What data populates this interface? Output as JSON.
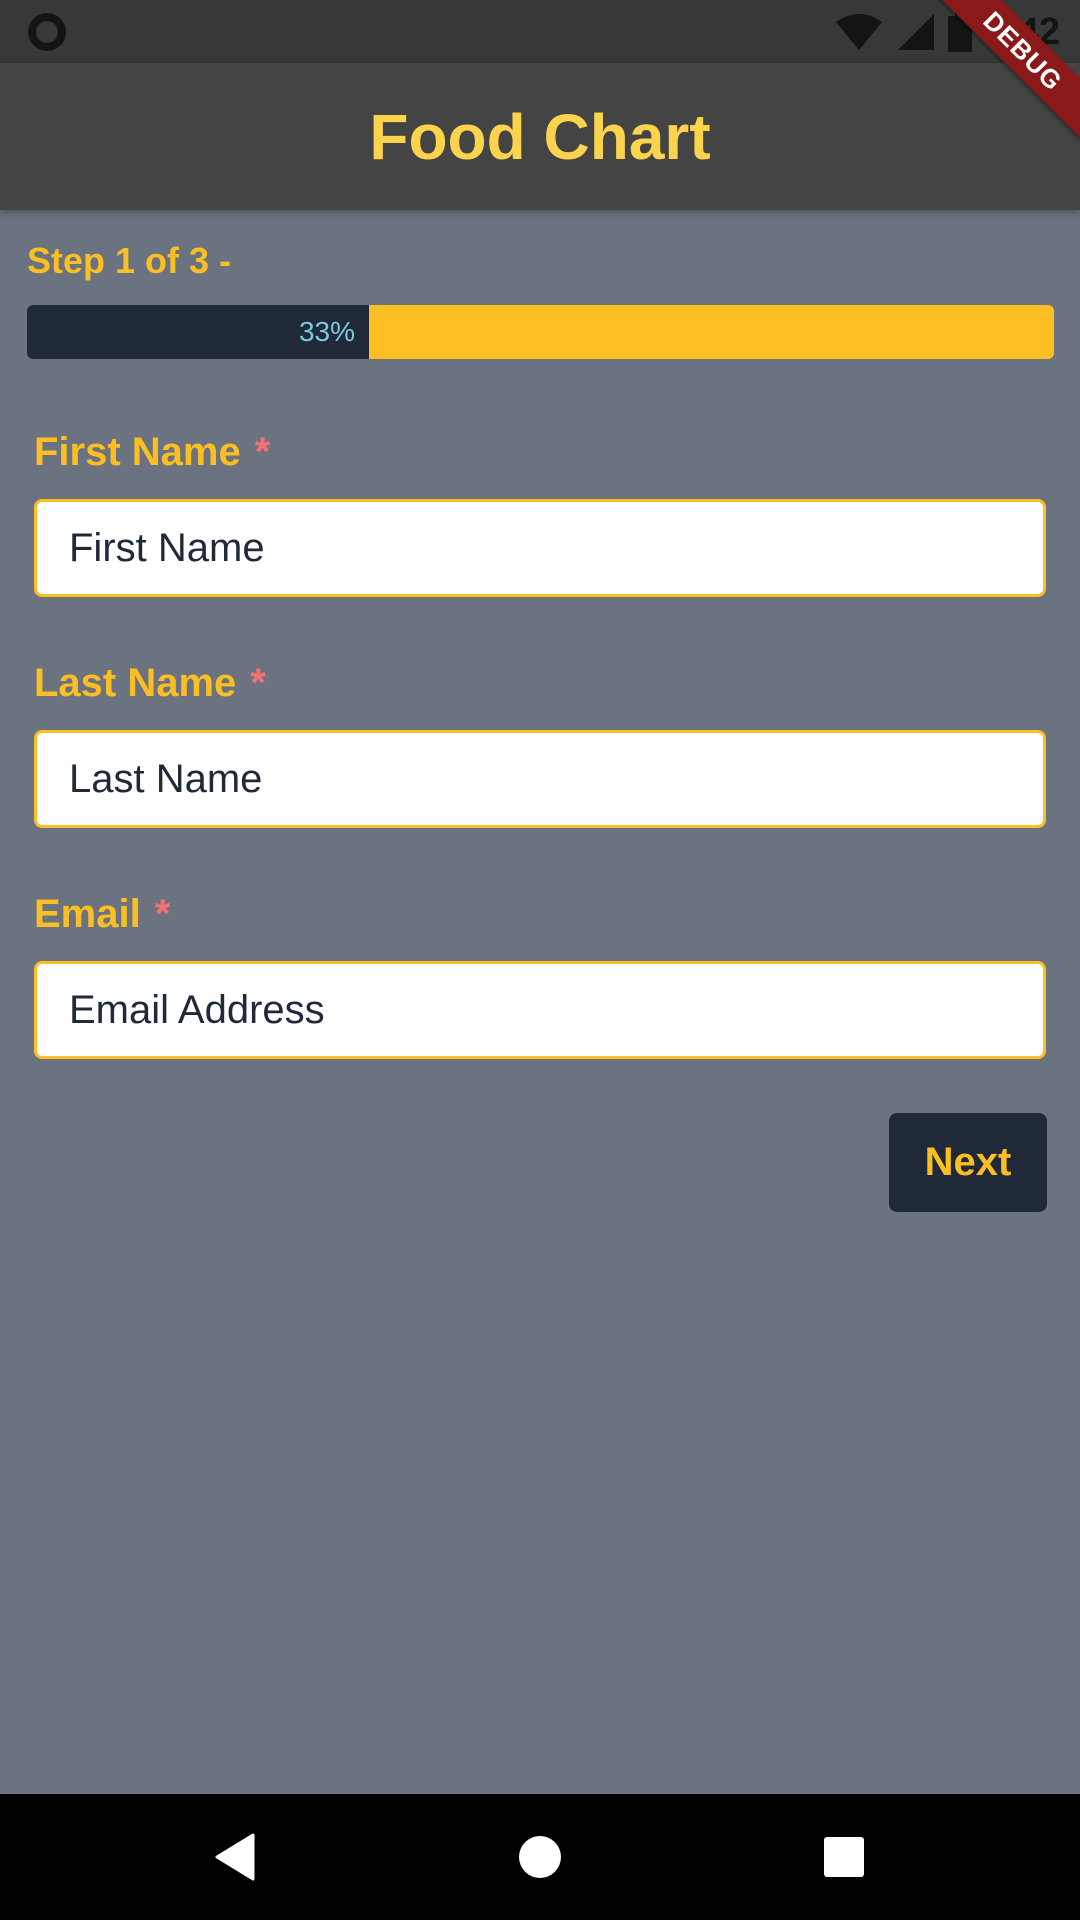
{
  "status_bar": {
    "time": "1:42",
    "icons": [
      "record-icon",
      "wifi-icon",
      "signal-icon",
      "battery-icon"
    ]
  },
  "debug_banner": "DEBUG",
  "app_bar": {
    "title": "Food Chart"
  },
  "progress": {
    "step_label": "Step 1 of 3 -",
    "percent_text": "33%",
    "value": 0.333
  },
  "form": {
    "fields": [
      {
        "label": "First Name",
        "required_mark": "*",
        "placeholder": "First Name",
        "value": ""
      },
      {
        "label": "Last Name",
        "required_mark": "*",
        "placeholder": "Last Name",
        "value": ""
      },
      {
        "label": "Email",
        "required_mark": "*",
        "placeholder": "Email Address",
        "value": ""
      }
    ],
    "next_label": "Next"
  },
  "nav_bar": {
    "icons": [
      "back-icon",
      "home-icon",
      "recents-icon"
    ]
  },
  "colors": {
    "background": "#6b7280",
    "app_bar": "#444444",
    "accent": "#fbbf24",
    "title": "#fcd34d",
    "required": "#f87171",
    "dark": "#1f2937"
  }
}
